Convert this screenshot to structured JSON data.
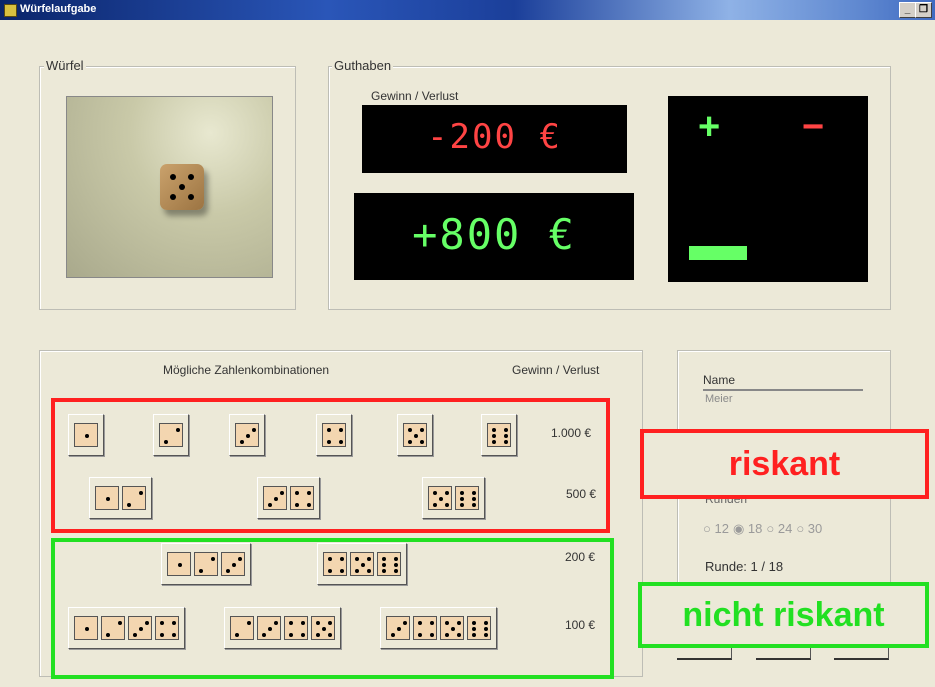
{
  "window": {
    "title": "Würfelaufgabe"
  },
  "wuerfel": {
    "label": "Würfel",
    "current_face": 5
  },
  "guthaben": {
    "label": "Guthaben",
    "display_caption": "Gewinn / Verlust",
    "last_result": "-200 €",
    "balance": "+800 €",
    "plus_sign": "+",
    "minus_sign": "−"
  },
  "kombinationen": {
    "header": "Mögliche Zahlenkombinationen",
    "value_header": "Gewinn / Verlust",
    "rows": [
      {
        "amount": "1.000 €",
        "faces": [
          [
            1
          ],
          [
            2
          ],
          [
            3
          ],
          [
            4
          ],
          [
            5
          ],
          [
            6
          ]
        ]
      },
      {
        "amount": "500 €",
        "faces": [
          [
            1,
            2
          ],
          [
            3,
            4
          ],
          [
            5,
            6
          ]
        ]
      },
      {
        "amount": "200 €",
        "faces": [
          [
            1,
            2,
            3
          ],
          [
            4,
            5,
            6
          ]
        ]
      },
      {
        "amount": "100 €",
        "faces": [
          [
            1,
            2,
            3,
            4
          ],
          [
            2,
            3,
            4,
            5
          ],
          [
            3,
            4,
            5,
            6
          ]
        ]
      }
    ]
  },
  "player": {
    "name_label": "Name",
    "name_value": "Meier",
    "runden_label": "Runden",
    "round_options": [
      "12",
      "18",
      "24",
      "30"
    ],
    "selected_rounds": "18",
    "runde_text": "Runde:  1 / 18"
  },
  "annotations": {
    "risky": "riskant",
    "safe": "nicht riskant"
  },
  "colors": {
    "red": "#ff2020",
    "green": "#22e022",
    "loss_text": "#ff4444",
    "gain_text": "#66ff66"
  }
}
